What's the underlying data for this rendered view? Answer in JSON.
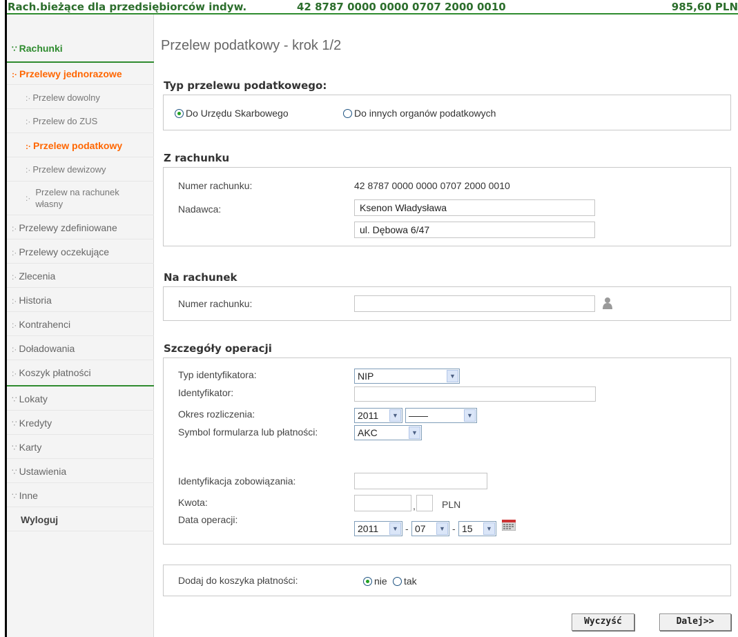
{
  "header": {
    "account_name": "Rach.bieżące dla przedsiębiorców indyw.",
    "account_number": "42 8787 0000 0000 0707 2000 0010",
    "balance": "985,60 PLN"
  },
  "sidebar": {
    "rachunki": "Rachunki",
    "przelewy_jednorazowe": "Przelewy jednorazowe",
    "sub": [
      "Przelew dowolny",
      "Przelew do ZUS",
      "Przelew podatkowy",
      "Przelew dewizowy"
    ],
    "sub_last_line1": "Przelew na rachunek",
    "sub_last_line2": "własny",
    "items_a": [
      "Przelewy zdefiniowane",
      "Przelewy oczekujące",
      "Zlecenia",
      "Historia",
      "Kontrahenci",
      "Doładowania",
      "Koszyk płatności"
    ],
    "items_b": [
      "Lokaty",
      "Kredyty",
      "Karty",
      "Ustawienia",
      "Inne"
    ],
    "logout": "Wyloguj"
  },
  "main": {
    "page_title": "Przelew podatkowy - krok 1/2",
    "type_section": {
      "title": "Typ przelewu podatkowego:",
      "option_us": "Do Urzędu Skarbowego",
      "option_other": "Do innych organów podatkowych",
      "selected": "Do Urzędu Skarbowego"
    },
    "from_section": {
      "title": "Z rachunku",
      "account_label": "Numer rachunku:",
      "account_value": "42 8787 0000 0000 0707 2000 0010",
      "sender_label": "Nadawca:",
      "sender_name": "Ksenon Władysława",
      "sender_address": "ul. Dębowa 6/47"
    },
    "to_section": {
      "title": "Na rachunek",
      "account_label": "Numer rachunku:",
      "account_value": ""
    },
    "details_section": {
      "title": "Szczegóły operacji",
      "id_type_label": "Typ identyfikatora:",
      "id_type_value": "NIP",
      "identifier_label": "Identyfikator:",
      "identifier_value": "",
      "period_label": "Okres rozliczenia:",
      "period_year": "2011",
      "period_value": "——",
      "form_symbol_label": "Symbol formularza lub płatności:",
      "form_symbol_value": "AKC",
      "liability_label": "Identyfikacja zobowiązania:",
      "liability_value": "",
      "amount_label": "Kwota:",
      "amount_int": "",
      "amount_sep": ",",
      "amount_dec": "",
      "currency": "PLN",
      "date_label": "Data operacji:",
      "date_year": "2011",
      "date_month": "07",
      "date_day": "15",
      "date_dash": "-"
    },
    "basket_section": {
      "label": "Dodaj do koszyka płatności:",
      "option_no": "nie",
      "option_yes": "tak",
      "selected": "nie"
    },
    "buttons": {
      "clear": "Wyczyść",
      "next": "Dalej>>"
    }
  },
  "colors": {
    "green": "#2e8b2e",
    "orange": "#ff6600"
  }
}
